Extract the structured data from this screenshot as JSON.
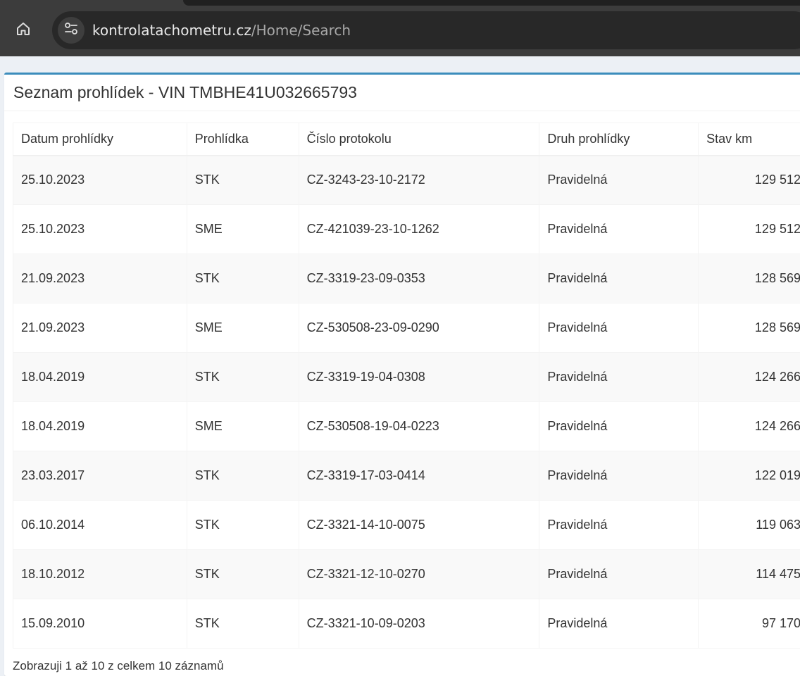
{
  "browser": {
    "url_host": "kontrolatachometru.cz",
    "url_path": "/Home/Search",
    "home_icon": "home-icon",
    "site_info_icon": "tune-icon"
  },
  "panel": {
    "title": "Seznam prohlídek - VIN TMBHE41U032665793"
  },
  "table": {
    "headers": [
      "Datum prohlídky",
      "Prohlídka",
      "Číslo protokolu",
      "Druh prohlídky",
      "Stav km"
    ],
    "rows": [
      [
        "25.10.2023",
        "STK",
        "CZ-3243-23-10-2172",
        "Pravidelná",
        "129 512"
      ],
      [
        "25.10.2023",
        "SME",
        "CZ-421039-23-10-1262",
        "Pravidelná",
        "129 512"
      ],
      [
        "21.09.2023",
        "STK",
        "CZ-3319-23-09-0353",
        "Pravidelná",
        "128 569"
      ],
      [
        "21.09.2023",
        "SME",
        "CZ-530508-23-09-0290",
        "Pravidelná",
        "128 569"
      ],
      [
        "18.04.2019",
        "STK",
        "CZ-3319-19-04-0308",
        "Pravidelná",
        "124 266"
      ],
      [
        "18.04.2019",
        "SME",
        "CZ-530508-19-04-0223",
        "Pravidelná",
        "124 266"
      ],
      [
        "23.03.2017",
        "STK",
        "CZ-3319-17-03-0414",
        "Pravidelná",
        "122 019"
      ],
      [
        "06.10.2014",
        "STK",
        "CZ-3321-14-10-0075",
        "Pravidelná",
        "119 063"
      ],
      [
        "18.10.2012",
        "STK",
        "CZ-3321-12-10-0270",
        "Pravidelná",
        "114 475"
      ],
      [
        "15.09.2010",
        "STK",
        "CZ-3321-10-09-0203",
        "Pravidelná",
        "97 170"
      ]
    ]
  },
  "footer": {
    "info": "Zobrazuji 1 až 10 z celkem 10 záznamů"
  },
  "colors": {
    "accent": "#3c8dbc",
    "browser_bar": "#3c3c3c",
    "page_bg": "#ecf0f5",
    "stripe": "#f9f9f9"
  }
}
